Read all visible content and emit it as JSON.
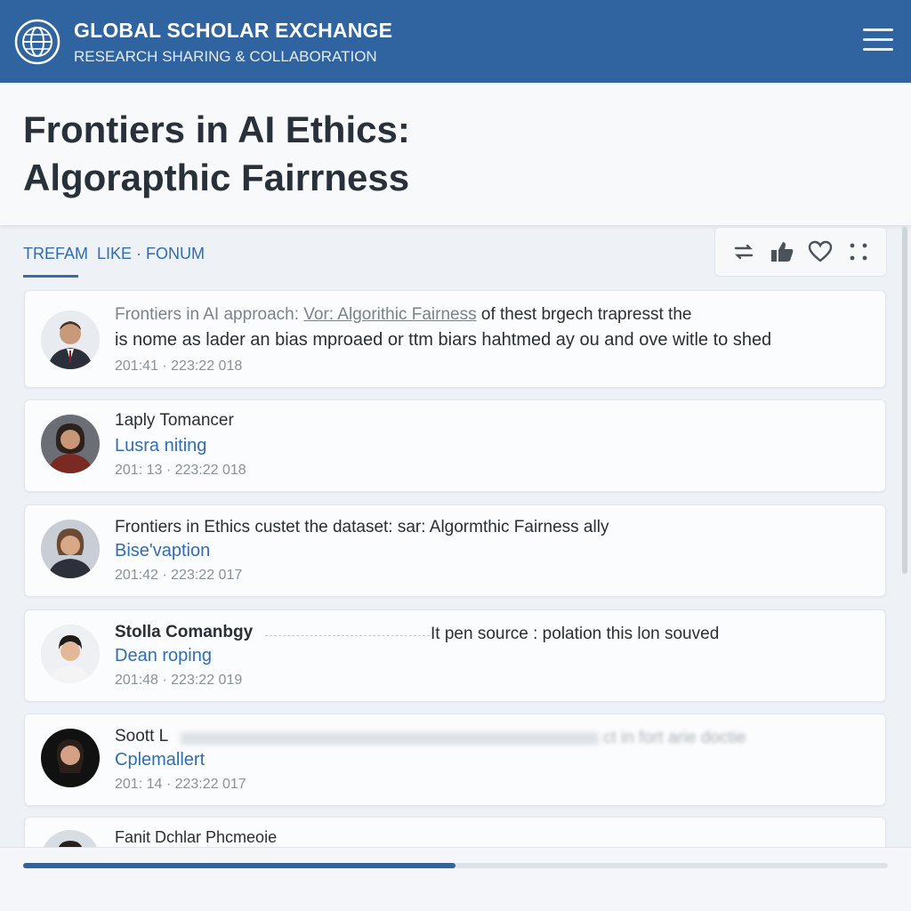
{
  "header": {
    "title": "GLOBAL SCHOLAR EXCHANGE",
    "subtitle": "RESEARCH SHARING & COLLABORATION",
    "logo_icon": "globe-icon",
    "menu_icon": "hamburger-menu-icon"
  },
  "page": {
    "title_line1": "Frontiers in AI Ethics:",
    "title_line2": "Algorapthic Fairrness"
  },
  "tabs": {
    "active": "TREFAM",
    "rest": "LIKE · FONUM"
  },
  "toolbar": {
    "icons": [
      "repost-icon",
      "thumbs-up-icon",
      "heart-icon",
      "more-icon"
    ]
  },
  "posts": [
    {
      "line1_a": "Frontiers in AI approach:",
      "line1_link": "Vor: Algorithic Fairness",
      "line1_b": "of thest brgech trapresst the",
      "line2": "is nome as lader an bias mproaed or ttm biars hahtmed ay ou and ove witle to shed",
      "time": "201:41 · 223:22 018"
    },
    {
      "line1": "1aply Tomancer",
      "line2": "Lusra niting",
      "time": "201: 13 · 223:22 018"
    },
    {
      "line1": "Frontiers in Ethics custet the dataset: sar: Algormthic Fairness ally",
      "line2": "Bise'vaption",
      "time": "201:42 · 223:22 017"
    },
    {
      "line1": "Stolla Comanbgy",
      "line1_extra": "It pen source : polation this lon souved",
      "line2": "Dean roping",
      "time": "201:48 · 223:22 019"
    },
    {
      "line1": "Soott L",
      "line1_extra": "ct in fort arie doctie",
      "line2": "Cplemallert",
      "time": "201: 14 · 223:22 017"
    },
    {
      "line1": "Fanit Dchlar Phcmeoie"
    }
  ],
  "progress": {
    "fraction": 0.5
  },
  "colors": {
    "brand": "#2f64a0",
    "accent": "#2f6db4",
    "text": "#28303a"
  }
}
